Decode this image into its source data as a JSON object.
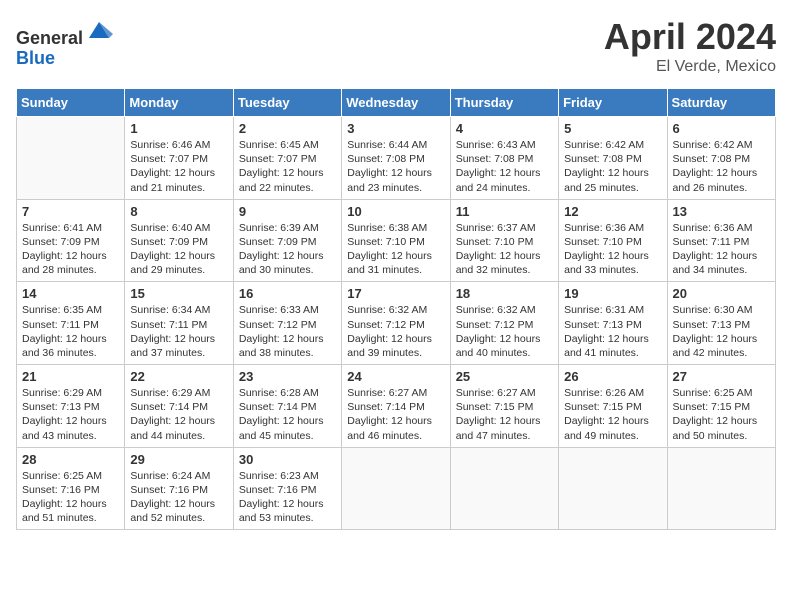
{
  "header": {
    "logo_line1": "General",
    "logo_line2": "Blue",
    "month": "April 2024",
    "location": "El Verde, Mexico"
  },
  "weekdays": [
    "Sunday",
    "Monday",
    "Tuesday",
    "Wednesday",
    "Thursday",
    "Friday",
    "Saturday"
  ],
  "weeks": [
    [
      {
        "day": "",
        "sunrise": "",
        "sunset": "",
        "daylight": ""
      },
      {
        "day": "1",
        "sunrise": "6:46 AM",
        "sunset": "7:07 PM",
        "daylight": "12 hours and 21 minutes."
      },
      {
        "day": "2",
        "sunrise": "6:45 AM",
        "sunset": "7:07 PM",
        "daylight": "12 hours and 22 minutes."
      },
      {
        "day": "3",
        "sunrise": "6:44 AM",
        "sunset": "7:08 PM",
        "daylight": "12 hours and 23 minutes."
      },
      {
        "day": "4",
        "sunrise": "6:43 AM",
        "sunset": "7:08 PM",
        "daylight": "12 hours and 24 minutes."
      },
      {
        "day": "5",
        "sunrise": "6:42 AM",
        "sunset": "7:08 PM",
        "daylight": "12 hours and 25 minutes."
      },
      {
        "day": "6",
        "sunrise": "6:42 AM",
        "sunset": "7:08 PM",
        "daylight": "12 hours and 26 minutes."
      }
    ],
    [
      {
        "day": "7",
        "sunrise": "6:41 AM",
        "sunset": "7:09 PM",
        "daylight": "12 hours and 28 minutes."
      },
      {
        "day": "8",
        "sunrise": "6:40 AM",
        "sunset": "7:09 PM",
        "daylight": "12 hours and 29 minutes."
      },
      {
        "day": "9",
        "sunrise": "6:39 AM",
        "sunset": "7:09 PM",
        "daylight": "12 hours and 30 minutes."
      },
      {
        "day": "10",
        "sunrise": "6:38 AM",
        "sunset": "7:10 PM",
        "daylight": "12 hours and 31 minutes."
      },
      {
        "day": "11",
        "sunrise": "6:37 AM",
        "sunset": "7:10 PM",
        "daylight": "12 hours and 32 minutes."
      },
      {
        "day": "12",
        "sunrise": "6:36 AM",
        "sunset": "7:10 PM",
        "daylight": "12 hours and 33 minutes."
      },
      {
        "day": "13",
        "sunrise": "6:36 AM",
        "sunset": "7:11 PM",
        "daylight": "12 hours and 34 minutes."
      }
    ],
    [
      {
        "day": "14",
        "sunrise": "6:35 AM",
        "sunset": "7:11 PM",
        "daylight": "12 hours and 36 minutes."
      },
      {
        "day": "15",
        "sunrise": "6:34 AM",
        "sunset": "7:11 PM",
        "daylight": "12 hours and 37 minutes."
      },
      {
        "day": "16",
        "sunrise": "6:33 AM",
        "sunset": "7:12 PM",
        "daylight": "12 hours and 38 minutes."
      },
      {
        "day": "17",
        "sunrise": "6:32 AM",
        "sunset": "7:12 PM",
        "daylight": "12 hours and 39 minutes."
      },
      {
        "day": "18",
        "sunrise": "6:32 AM",
        "sunset": "7:12 PM",
        "daylight": "12 hours and 40 minutes."
      },
      {
        "day": "19",
        "sunrise": "6:31 AM",
        "sunset": "7:13 PM",
        "daylight": "12 hours and 41 minutes."
      },
      {
        "day": "20",
        "sunrise": "6:30 AM",
        "sunset": "7:13 PM",
        "daylight": "12 hours and 42 minutes."
      }
    ],
    [
      {
        "day": "21",
        "sunrise": "6:29 AM",
        "sunset": "7:13 PM",
        "daylight": "12 hours and 43 minutes."
      },
      {
        "day": "22",
        "sunrise": "6:29 AM",
        "sunset": "7:14 PM",
        "daylight": "12 hours and 44 minutes."
      },
      {
        "day": "23",
        "sunrise": "6:28 AM",
        "sunset": "7:14 PM",
        "daylight": "12 hours and 45 minutes."
      },
      {
        "day": "24",
        "sunrise": "6:27 AM",
        "sunset": "7:14 PM",
        "daylight": "12 hours and 46 minutes."
      },
      {
        "day": "25",
        "sunrise": "6:27 AM",
        "sunset": "7:15 PM",
        "daylight": "12 hours and 47 minutes."
      },
      {
        "day": "26",
        "sunrise": "6:26 AM",
        "sunset": "7:15 PM",
        "daylight": "12 hours and 49 minutes."
      },
      {
        "day": "27",
        "sunrise": "6:25 AM",
        "sunset": "7:15 PM",
        "daylight": "12 hours and 50 minutes."
      }
    ],
    [
      {
        "day": "28",
        "sunrise": "6:25 AM",
        "sunset": "7:16 PM",
        "daylight": "12 hours and 51 minutes."
      },
      {
        "day": "29",
        "sunrise": "6:24 AM",
        "sunset": "7:16 PM",
        "daylight": "12 hours and 52 minutes."
      },
      {
        "day": "30",
        "sunrise": "6:23 AM",
        "sunset": "7:16 PM",
        "daylight": "12 hours and 53 minutes."
      },
      {
        "day": "",
        "sunrise": "",
        "sunset": "",
        "daylight": ""
      },
      {
        "day": "",
        "sunrise": "",
        "sunset": "",
        "daylight": ""
      },
      {
        "day": "",
        "sunrise": "",
        "sunset": "",
        "daylight": ""
      },
      {
        "day": "",
        "sunrise": "",
        "sunset": "",
        "daylight": ""
      }
    ]
  ]
}
